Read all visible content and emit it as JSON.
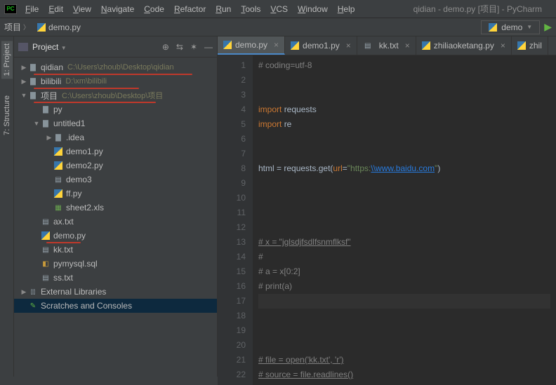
{
  "window": {
    "title": "qidian - demo.py [项目] - PyCharm"
  },
  "menu": [
    "File",
    "Edit",
    "View",
    "Navigate",
    "Code",
    "Refactor",
    "Run",
    "Tools",
    "VCS",
    "Window",
    "Help"
  ],
  "breadcrumb": {
    "root": "项目",
    "file": "demo.py"
  },
  "run_config": {
    "label": "demo"
  },
  "side": {
    "title": "Project",
    "tabs": {
      "project": "1: Project",
      "structure": "7: Structure"
    }
  },
  "tree": [
    {
      "depth": 0,
      "arrow": "▶",
      "icon": "folder",
      "label": "qidian",
      "path": "C:\\Users\\zhoub\\Desktop\\qidian",
      "underline": true
    },
    {
      "depth": 0,
      "arrow": "▶",
      "icon": "folder",
      "label": "bilibili",
      "path": "D:\\xm\\bilibili",
      "underline": true
    },
    {
      "depth": 0,
      "arrow": "▼",
      "icon": "folder",
      "label": "项目",
      "path": "C:\\Users\\zhoub\\Desktop\\项目",
      "underline": true
    },
    {
      "depth": 1,
      "arrow": "",
      "icon": "folder",
      "label": "py"
    },
    {
      "depth": 1,
      "arrow": "▼",
      "icon": "folder",
      "label": "untitled1"
    },
    {
      "depth": 2,
      "arrow": "▶",
      "icon": "folder",
      "label": ".idea"
    },
    {
      "depth": 2,
      "arrow": "",
      "icon": "py",
      "label": "demo1.py"
    },
    {
      "depth": 2,
      "arrow": "",
      "icon": "py",
      "label": "demo2.py"
    },
    {
      "depth": 2,
      "arrow": "",
      "icon": "txt",
      "label": "demo3"
    },
    {
      "depth": 2,
      "arrow": "",
      "icon": "py",
      "label": "ff.py"
    },
    {
      "depth": 2,
      "arrow": "",
      "icon": "xls",
      "label": "sheet2.xls"
    },
    {
      "depth": 1,
      "arrow": "",
      "icon": "txt",
      "label": "ax.txt"
    },
    {
      "depth": 1,
      "arrow": "",
      "icon": "py",
      "label": "demo.py",
      "underline": true
    },
    {
      "depth": 1,
      "arrow": "",
      "icon": "txt",
      "label": "kk.txt"
    },
    {
      "depth": 1,
      "arrow": "",
      "icon": "sql",
      "label": "pymysql.sql"
    },
    {
      "depth": 1,
      "arrow": "",
      "icon": "txt",
      "label": "ss.txt"
    },
    {
      "depth": 0,
      "arrow": "▶",
      "icon": "lib",
      "label": "External Libraries"
    },
    {
      "depth": 0,
      "arrow": "",
      "icon": "scratch",
      "label": "Scratches and Consoles",
      "selected": true
    }
  ],
  "tabs": [
    {
      "label": "demo.py",
      "icon": "py",
      "active": true
    },
    {
      "label": "demo1.py",
      "icon": "py"
    },
    {
      "label": "kk.txt",
      "icon": "txt"
    },
    {
      "label": "zhiliaoketang.py",
      "icon": "py"
    },
    {
      "label": "zhil",
      "icon": "py",
      "noclose": true
    }
  ],
  "code": {
    "lines": [
      {
        "n": 1,
        "html": "<span class='c-comment'># coding=utf-8</span>"
      },
      {
        "n": 2,
        "html": ""
      },
      {
        "n": 3,
        "html": ""
      },
      {
        "n": 4,
        "html": "<span class='c-kw'>import </span><span class='c-id'>requests</span>"
      },
      {
        "n": 5,
        "html": "<span class='c-kw'>import </span><span class='c-id'>re</span>"
      },
      {
        "n": 6,
        "html": ""
      },
      {
        "n": 7,
        "html": ""
      },
      {
        "n": 8,
        "html": "<span class='c-id'>html = requests</span><span class='c-dot'>.</span><span class='c-id'>get</span><span class='c-par'>(</span><span class='c-url'>url</span><span class='c-lit'>=</span><span class='c-str'>\"https:</span><span class='c-link'>\\\\www.baidu.com</span><span class='c-str'>\"</span><span class='c-par'>)</span>"
      },
      {
        "n": 9,
        "html": ""
      },
      {
        "n": 10,
        "html": ""
      },
      {
        "n": 11,
        "html": ""
      },
      {
        "n": 12,
        "html": ""
      },
      {
        "n": 13,
        "html": "<span class='c-comment c-underline'># x = \"jglsdjfsdlfsnmflksf\"</span>"
      },
      {
        "n": 14,
        "html": "<span class='c-comment'>#</span>"
      },
      {
        "n": 15,
        "html": "<span class='c-comment'># a = x[0:2]</span>"
      },
      {
        "n": 16,
        "html": "<span class='c-comment'># print(a)</span>"
      },
      {
        "n": 17,
        "html": "",
        "caret": true
      },
      {
        "n": 18,
        "html": ""
      },
      {
        "n": 19,
        "html": ""
      },
      {
        "n": 20,
        "html": ""
      },
      {
        "n": 21,
        "html": "<span class='c-comment c-underline'># file = open('kk.txt', 'r')</span>"
      },
      {
        "n": 22,
        "html": "<span class='c-comment c-underline'># source = file.readlines()</span>"
      }
    ]
  }
}
